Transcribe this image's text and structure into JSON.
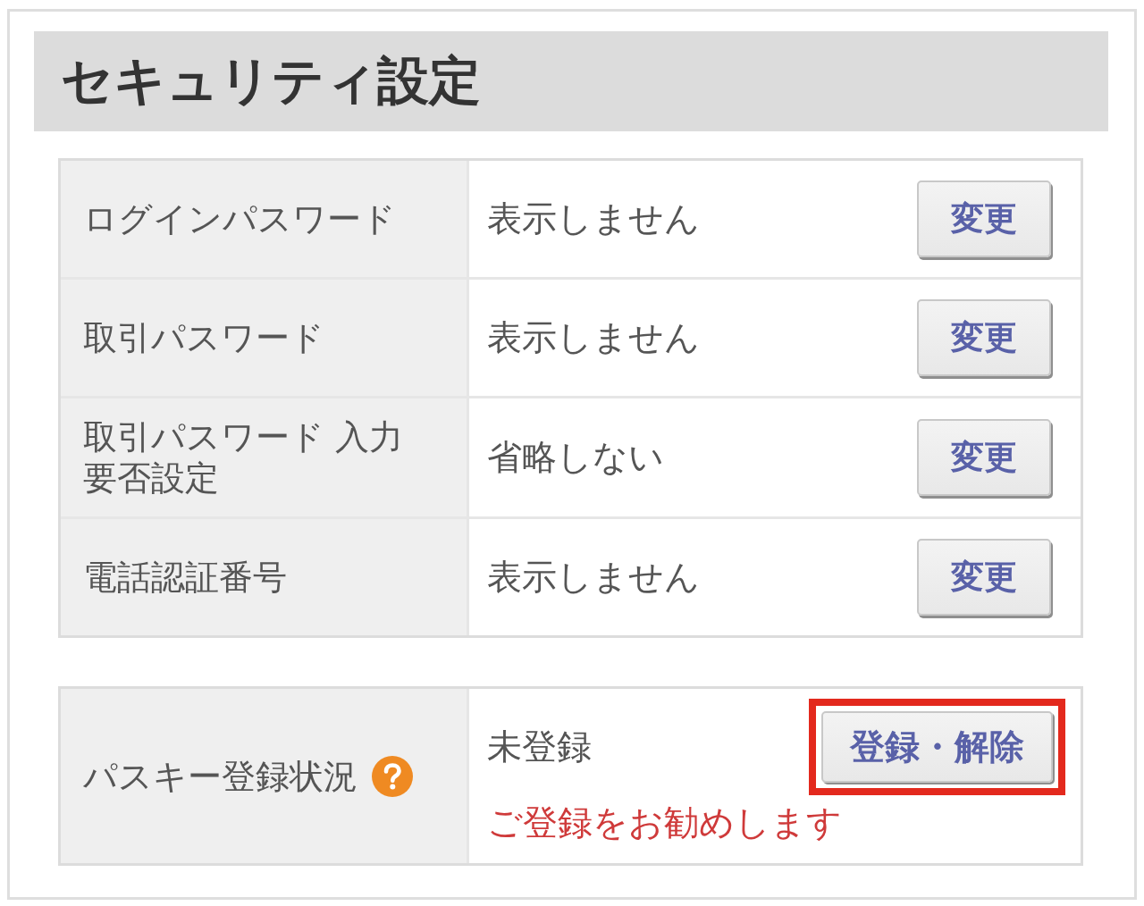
{
  "title": "セキュリティ設定",
  "settings": [
    {
      "label": "ログインパスワード",
      "value": "表示しません",
      "button": "変更"
    },
    {
      "label": "取引パスワード",
      "value": "表示しません",
      "button": "変更"
    },
    {
      "label": "取引パスワード 入力要否設定",
      "value": "省略しない",
      "button": "変更"
    },
    {
      "label": "電話認証番号",
      "value": "表示しません",
      "button": "変更"
    }
  ],
  "passkey": {
    "label": "パスキー登録状況",
    "status": "未登録",
    "notice": "ご登録をお勧めします",
    "button": {
      "label": "登録・解除",
      "highlighted": true
    }
  }
}
